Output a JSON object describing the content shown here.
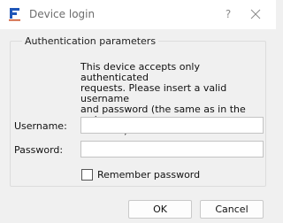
{
  "window": {
    "title": "Device login",
    "logo_letter": "F",
    "help_label": "?",
    "accent_color": "#1f56b8"
  },
  "group": {
    "title": "Authentication parameters",
    "info_lines": [
      "This device accepts only authenticated",
      "requests. Please insert a valid username",
      "and password (the same as in the web",
      "interface)"
    ]
  },
  "form": {
    "username_label": "Username:",
    "username_value": "",
    "password_label": "Password:",
    "password_value": "",
    "remember_label": "Remember password",
    "remember_checked": false
  },
  "buttons": {
    "ok": "OK",
    "cancel": "Cancel"
  }
}
